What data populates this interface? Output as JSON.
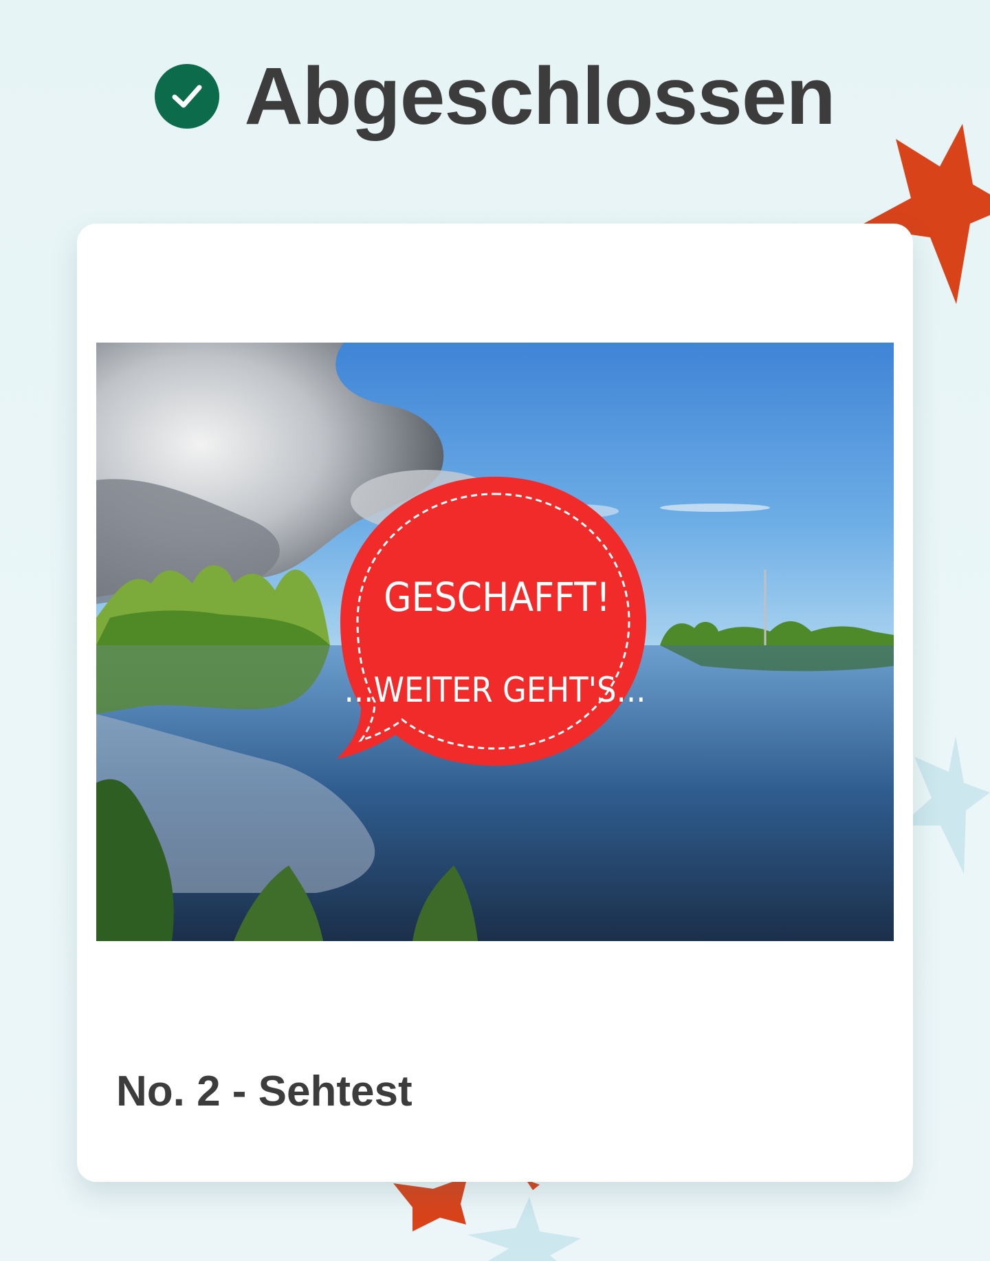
{
  "header": {
    "icon": "check-circle-icon",
    "title": "Abgeschlossen",
    "icon_color": "#0b6b4b"
  },
  "card": {
    "image": {
      "description_icon": "lake-landscape-image",
      "bubble_line1": "GESCHAFFT!",
      "bubble_line2": "...WEITER GEHT'S...",
      "bubble_color": "#f12a2a"
    },
    "title": "No. 2 - Sehtest"
  },
  "decorations": {
    "star_orange_color": "#d8431a",
    "star_blue_color": "#cce7ee"
  }
}
